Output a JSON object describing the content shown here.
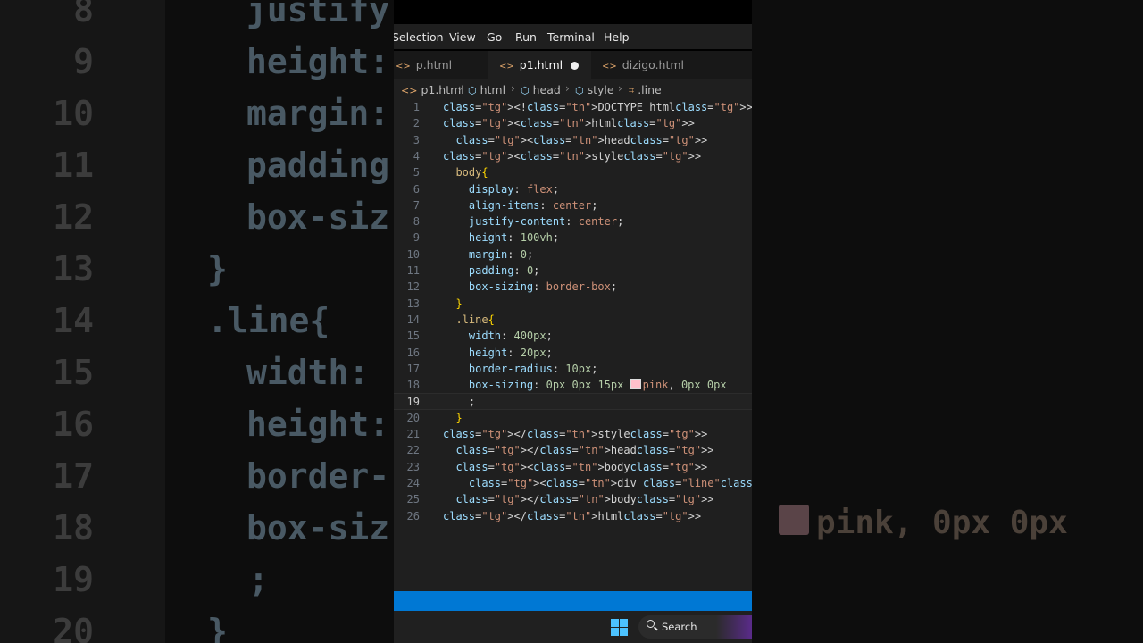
{
  "menu": [
    "Selection",
    "View",
    "Go",
    "Run",
    "Terminal",
    "Help"
  ],
  "tabs": [
    {
      "label": "p.html",
      "active": false
    },
    {
      "label": "p1.html",
      "active": true,
      "modified": true
    },
    {
      "label": "dizigo.html",
      "active": false
    }
  ],
  "breadcrumb": [
    "p1.html",
    "html",
    "head",
    "style",
    ".line"
  ],
  "current_line": 19,
  "code_lines": [
    "<!DOCTYPE html>",
    "<html>",
    "  <head>",
    "<style>",
    "  body{",
    "    display: flex;",
    "    align-items: center;",
    "    justify-content: center;",
    "    height: 100vh;",
    "    margin: 0;",
    "    padding: 0;",
    "    box-sizing: border-box;",
    "  }",
    "  .line{",
    "    width: 400px;",
    "    height: 20px;",
    "    border-radius: 10px;",
    "    box-sizing: 0px 0px 15px pink, 0px 0px",
    "    ;",
    "  }",
    "</style>",
    "  </head>",
    "  <body>",
    "    <div class=\"line\"></div>",
    "  </body>",
    "</html>"
  ],
  "line_numbers": [
    "1",
    "2",
    "3",
    "4",
    "5",
    "6",
    "7",
    "8",
    "9",
    "10",
    "11",
    "12",
    "13",
    "14",
    "15",
    "16",
    "17",
    "18",
    "19",
    "20",
    "21",
    "22",
    "23",
    "24",
    "25",
    "26"
  ],
  "taskbar": {
    "search_label": "Search"
  },
  "colors": {
    "status_bar": "#0078d4",
    "swatch_pink": "#ffc0cb"
  },
  "background_zoom_left": {
    "line_numbers": [
      "8",
      "9",
      "10",
      "11",
      "12",
      "13",
      "14",
      "15",
      "16",
      "17",
      "18",
      "19",
      "20"
    ],
    "code": [
      "justify",
      "height:",
      "margin:",
      "padding",
      "box-siz",
      "}",
      ".line{",
      "width:",
      "height:",
      "border-",
      "box-siz",
      ";",
      "}"
    ]
  },
  "background_zoom_right": {
    "code": "pink, 0px 0px"
  }
}
